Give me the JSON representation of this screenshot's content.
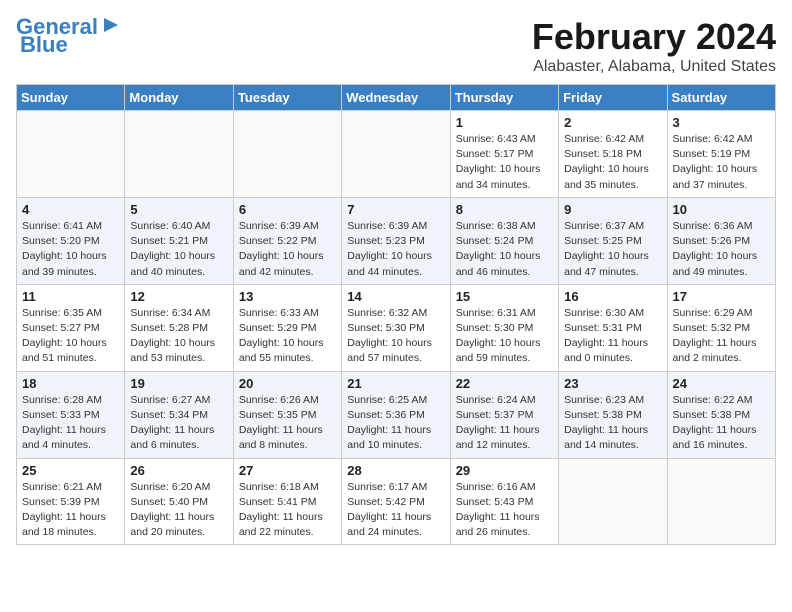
{
  "logo": {
    "line1": "General",
    "line2": "Blue"
  },
  "header": {
    "month": "February 2024",
    "location": "Alabaster, Alabama, United States"
  },
  "days_of_week": [
    "Sunday",
    "Monday",
    "Tuesday",
    "Wednesday",
    "Thursday",
    "Friday",
    "Saturday"
  ],
  "weeks": [
    [
      {
        "day": "",
        "info": ""
      },
      {
        "day": "",
        "info": ""
      },
      {
        "day": "",
        "info": ""
      },
      {
        "day": "",
        "info": ""
      },
      {
        "day": "1",
        "info": "Sunrise: 6:43 AM\nSunset: 5:17 PM\nDaylight: 10 hours\nand 34 minutes."
      },
      {
        "day": "2",
        "info": "Sunrise: 6:42 AM\nSunset: 5:18 PM\nDaylight: 10 hours\nand 35 minutes."
      },
      {
        "day": "3",
        "info": "Sunrise: 6:42 AM\nSunset: 5:19 PM\nDaylight: 10 hours\nand 37 minutes."
      }
    ],
    [
      {
        "day": "4",
        "info": "Sunrise: 6:41 AM\nSunset: 5:20 PM\nDaylight: 10 hours\nand 39 minutes."
      },
      {
        "day": "5",
        "info": "Sunrise: 6:40 AM\nSunset: 5:21 PM\nDaylight: 10 hours\nand 40 minutes."
      },
      {
        "day": "6",
        "info": "Sunrise: 6:39 AM\nSunset: 5:22 PM\nDaylight: 10 hours\nand 42 minutes."
      },
      {
        "day": "7",
        "info": "Sunrise: 6:39 AM\nSunset: 5:23 PM\nDaylight: 10 hours\nand 44 minutes."
      },
      {
        "day": "8",
        "info": "Sunrise: 6:38 AM\nSunset: 5:24 PM\nDaylight: 10 hours\nand 46 minutes."
      },
      {
        "day": "9",
        "info": "Sunrise: 6:37 AM\nSunset: 5:25 PM\nDaylight: 10 hours\nand 47 minutes."
      },
      {
        "day": "10",
        "info": "Sunrise: 6:36 AM\nSunset: 5:26 PM\nDaylight: 10 hours\nand 49 minutes."
      }
    ],
    [
      {
        "day": "11",
        "info": "Sunrise: 6:35 AM\nSunset: 5:27 PM\nDaylight: 10 hours\nand 51 minutes."
      },
      {
        "day": "12",
        "info": "Sunrise: 6:34 AM\nSunset: 5:28 PM\nDaylight: 10 hours\nand 53 minutes."
      },
      {
        "day": "13",
        "info": "Sunrise: 6:33 AM\nSunset: 5:29 PM\nDaylight: 10 hours\nand 55 minutes."
      },
      {
        "day": "14",
        "info": "Sunrise: 6:32 AM\nSunset: 5:30 PM\nDaylight: 10 hours\nand 57 minutes."
      },
      {
        "day": "15",
        "info": "Sunrise: 6:31 AM\nSunset: 5:30 PM\nDaylight: 10 hours\nand 59 minutes."
      },
      {
        "day": "16",
        "info": "Sunrise: 6:30 AM\nSunset: 5:31 PM\nDaylight: 11 hours\nand 0 minutes."
      },
      {
        "day": "17",
        "info": "Sunrise: 6:29 AM\nSunset: 5:32 PM\nDaylight: 11 hours\nand 2 minutes."
      }
    ],
    [
      {
        "day": "18",
        "info": "Sunrise: 6:28 AM\nSunset: 5:33 PM\nDaylight: 11 hours\nand 4 minutes."
      },
      {
        "day": "19",
        "info": "Sunrise: 6:27 AM\nSunset: 5:34 PM\nDaylight: 11 hours\nand 6 minutes."
      },
      {
        "day": "20",
        "info": "Sunrise: 6:26 AM\nSunset: 5:35 PM\nDaylight: 11 hours\nand 8 minutes."
      },
      {
        "day": "21",
        "info": "Sunrise: 6:25 AM\nSunset: 5:36 PM\nDaylight: 11 hours\nand 10 minutes."
      },
      {
        "day": "22",
        "info": "Sunrise: 6:24 AM\nSunset: 5:37 PM\nDaylight: 11 hours\nand 12 minutes."
      },
      {
        "day": "23",
        "info": "Sunrise: 6:23 AM\nSunset: 5:38 PM\nDaylight: 11 hours\nand 14 minutes."
      },
      {
        "day": "24",
        "info": "Sunrise: 6:22 AM\nSunset: 5:38 PM\nDaylight: 11 hours\nand 16 minutes."
      }
    ],
    [
      {
        "day": "25",
        "info": "Sunrise: 6:21 AM\nSunset: 5:39 PM\nDaylight: 11 hours\nand 18 minutes."
      },
      {
        "day": "26",
        "info": "Sunrise: 6:20 AM\nSunset: 5:40 PM\nDaylight: 11 hours\nand 20 minutes."
      },
      {
        "day": "27",
        "info": "Sunrise: 6:18 AM\nSunset: 5:41 PM\nDaylight: 11 hours\nand 22 minutes."
      },
      {
        "day": "28",
        "info": "Sunrise: 6:17 AM\nSunset: 5:42 PM\nDaylight: 11 hours\nand 24 minutes."
      },
      {
        "day": "29",
        "info": "Sunrise: 6:16 AM\nSunset: 5:43 PM\nDaylight: 11 hours\nand 26 minutes."
      },
      {
        "day": "",
        "info": ""
      },
      {
        "day": "",
        "info": ""
      }
    ]
  ]
}
